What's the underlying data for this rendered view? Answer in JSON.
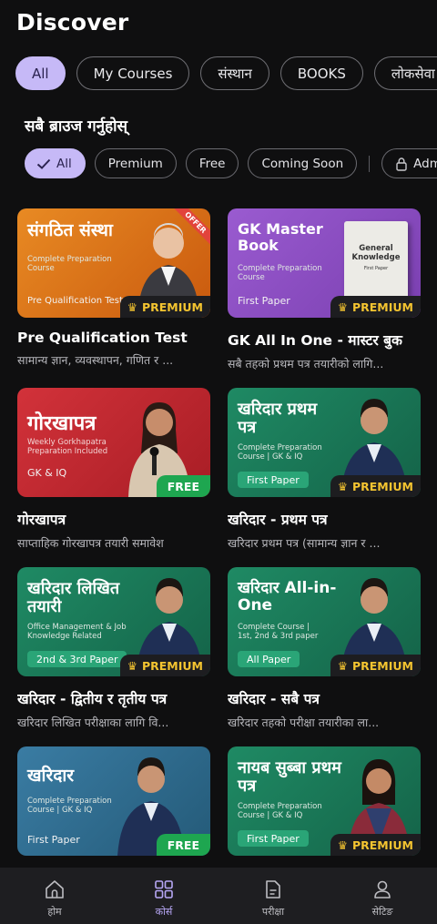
{
  "header": {
    "title": "Discover"
  },
  "categories": [
    "All",
    "My Courses",
    "संस्थान",
    "BOOKS",
    "लोकसेवा"
  ],
  "browse": {
    "heading": "सबै ब्राउज गर्नुहोस्",
    "filters": [
      "All",
      "Premium",
      "Free",
      "Coming Soon"
    ],
    "admin_label": "Admin:"
  },
  "courses": [
    {
      "title": "Pre Qualification Test",
      "desc": "सामान्य ज्ञान, व्यवस्थापन, गणित र ...",
      "thumb_title": "संगठित संस्था",
      "thumb_sub": "Complete Preparation Course",
      "thumb_tag": "Pre Qualification Test",
      "ribbon": "OFFER",
      "badge": "PREMIUM",
      "bg": "#e07b1a"
    },
    {
      "title": "GK All In One - मास्टर बुक",
      "desc": "सबै तहको प्रथम पत्र तयारीको लागि...",
      "thumb_title": "GK Master Book",
      "thumb_sub": "Complete Preparation Course",
      "thumb_tag": "First Paper",
      "book_title": "General Knowledge",
      "book_sub": "First Paper",
      "badge": "PREMIUM",
      "bg": "#8a4fc0"
    },
    {
      "title": "गोरखापत्र",
      "desc": "साप्ताहिक गोरखापत्र तयारी समावेश",
      "thumb_title": "गोरखापत्र",
      "thumb_sub": "Weekly Gorkhapatra Preparation Included",
      "thumb_tag": "GK & IQ",
      "badge": "FREE",
      "bg": "#c62a30"
    },
    {
      "title": "खरिदार - प्रथम पत्र",
      "desc": "खरिदार प्रथम पत्र (सामान्य ज्ञान र ...",
      "thumb_title": "खरिदार प्रथम पत्र",
      "thumb_sub": "Complete Preparation Course | GK & IQ",
      "thumb_tag": "First Paper",
      "badge": "PREMIUM",
      "bg": "#1c7a5a"
    },
    {
      "title": "खरिदार - द्वितीय र तृतीय पत्र",
      "desc": "खरिदार लिखित परीक्षाका लागि वि...",
      "thumb_title": "खरिदार लिखित तयारी",
      "thumb_sub": "Office Management & Job Knowledge Related",
      "thumb_tag": "2nd & 3rd Paper",
      "badge": "PREMIUM",
      "bg": "#1c7a5a"
    },
    {
      "title": "खरिदार - सबै पत्र",
      "desc": "खरिदार तहको परीक्षा तयारीका ला...",
      "thumb_title": "खरिदार All-in-One",
      "thumb_sub": "Complete Course | 1st, 2nd & 3rd paper",
      "thumb_tag": "All Paper",
      "badge": "PREMIUM",
      "bg": "#1c7a5a"
    },
    {
      "title": "",
      "desc": "",
      "thumb_title": "खरिदार",
      "thumb_sub": "Complete Preparation Course | GK & IQ",
      "thumb_tag": "First Paper",
      "badge": "FREE",
      "bg": "#2f6b8e"
    },
    {
      "title": "",
      "desc": "",
      "thumb_title": "नायब सुब्बा प्रथम पत्र",
      "thumb_sub": "Complete Preparation Course | GK & IQ",
      "thumb_tag": "First Paper",
      "badge": "PREMIUM",
      "bg": "#1c7a5a"
    }
  ],
  "bottom_nav": [
    {
      "label": "होम",
      "icon": "home-icon"
    },
    {
      "label": "कोर्स",
      "icon": "grid-icon",
      "active": true
    },
    {
      "label": "परीक्षा",
      "icon": "document-icon"
    },
    {
      "label": "सेटिङ",
      "icon": "person-icon"
    }
  ],
  "colors": {
    "accent": "#c6b9f7",
    "premium": "#f4c430",
    "free": "#1ea650",
    "background": "#0f0f10"
  }
}
